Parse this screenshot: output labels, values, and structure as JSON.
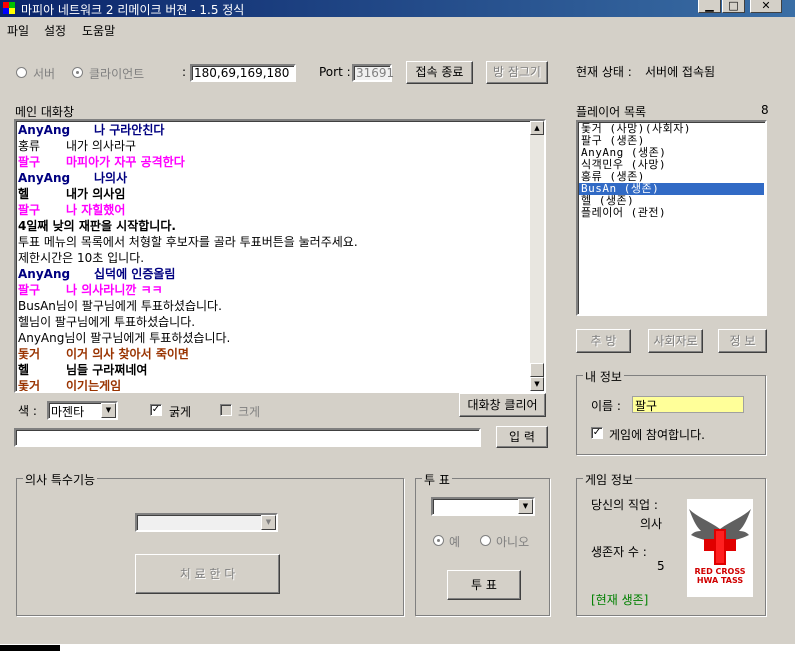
{
  "window": {
    "title": "마피아 네트워크 2 리메이크 버젼 - 1.5 정식",
    "minimize": "▁",
    "maximize": "□",
    "close": "✕"
  },
  "menu": [
    "파일",
    "설정",
    "도움말"
  ],
  "connection": {
    "server_label": "서버",
    "client_label": "클라이언트",
    "ip_label": ":",
    "ip_value": "180,69,169,180",
    "port_label": "Port :",
    "port_value": "31691",
    "disconnect_button": "접속 종료",
    "lock_room_button": "방 잠그기",
    "status_label": "현재 상태 :",
    "status_value": "서버에 접속됨"
  },
  "chat": {
    "title": "메인 대화창",
    "lines": [
      {
        "name": "AnyAng",
        "text": "나 구라안친다",
        "color": "#000080",
        "bold": true
      },
      {
        "name": "홍류",
        "text": "내가 의사라구",
        "color": "#000000",
        "bold": false
      },
      {
        "name": "팔구",
        "text": "마피아가 자꾸 공격한다",
        "color": "#ff00ff",
        "bold": true
      },
      {
        "name": "AnyAng",
        "text": "나의사",
        "color": "#000080",
        "bold": true
      },
      {
        "name": "헬",
        "text": "내가 의사임",
        "color": "#000000",
        "bold": true
      },
      {
        "name": "팔구",
        "text": "나 자힐했어",
        "color": "#ff00ff",
        "bold": true
      },
      {
        "name": "",
        "text": "4일째 낮의 재판을 시작합니다.",
        "color": "#000000",
        "bold": true
      },
      {
        "name": "",
        "text": "투표 메뉴의 목록에서 처형할 후보자를 골라 투표버튼을 눌러주세요.",
        "color": "#000000",
        "bold": false
      },
      {
        "name": "",
        "text": "제한시간은 10초 입니다.",
        "color": "#000000",
        "bold": false
      },
      {
        "name": "AnyAng",
        "text": "십덕에 인증올림",
        "color": "#000080",
        "bold": true
      },
      {
        "name": "팔구",
        "text": "나 의사라니깐 ㅋㅋ",
        "color": "#ff00ff",
        "bold": true
      },
      {
        "name": "",
        "text": "BusAn님이 팔구님에게 투표하셨습니다.",
        "color": "#000000",
        "bold": false
      },
      {
        "name": "",
        "text": "헬님이 팔구님에게 투표하셨습니다.",
        "color": "#000000",
        "bold": false
      },
      {
        "name": "",
        "text": "AnyAng님이 팔구님에게 투표하셨습니다.",
        "color": "#000000",
        "bold": false
      },
      {
        "name": "돛거",
        "text": "이거 의사 찾아서 죽이면",
        "color": "#993300",
        "bold": true
      },
      {
        "name": "헬",
        "text": "님들 구라쩌네여",
        "color": "#000000",
        "bold": true
      },
      {
        "name": "돛거",
        "text": "이기는게임",
        "color": "#993300",
        "bold": true
      }
    ],
    "clear_button": "대화창 클리어",
    "color_label": "색 :",
    "color_value": "마젠타",
    "bold_label": "굵게",
    "large_label": "크게",
    "input_value": "",
    "send_button": "입 력"
  },
  "players": {
    "title": "플레이어 목록",
    "count": "8",
    "list": [
      "돛거 (사망)(사회자)",
      "팔구 (생존)",
      "AnyAng (생존)",
      "식객민우 (사망)",
      "홍류 (생존)",
      "BusAn (생존)",
      "헬 (생존)",
      "플레이어 (관전)"
    ],
    "selected_index": 5,
    "kick_button": "추 방",
    "host_button": "사회자로",
    "info_button": "정 보"
  },
  "my_info": {
    "title": "내 정보",
    "name_label": "이름 :",
    "name_value": "팔구",
    "participate_label": "게임에 참여합니다."
  },
  "doctor": {
    "title": "의사 특수기능",
    "heal_button": "치 료 한 다"
  },
  "vote": {
    "title": "투 표",
    "yes_label": "예",
    "no_label": "아니오",
    "vote_button": "투 표"
  },
  "game_info": {
    "title": "게임 정보",
    "job_label": "당신의 직업 :",
    "job_value": "의사",
    "survivors_label": "생존자 수 :",
    "survivors_value": "5",
    "status": "[현재 생존]",
    "logo_line1": "RED CROSS",
    "logo_line2": "HWA TASS"
  }
}
